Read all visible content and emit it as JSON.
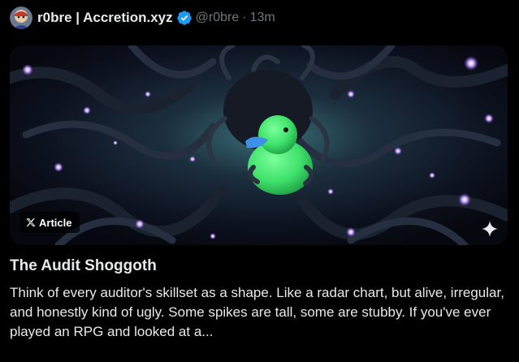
{
  "author": {
    "display_name": "r0bre | Accretion.xyz",
    "handle": "@r0bre",
    "separator": "·",
    "timestamp": "13m",
    "verified_icon": "verified-badge-icon",
    "verified_color": "#1d9bf0"
  },
  "card": {
    "badge_label": "Article",
    "badge_icon": "x-logo-icon",
    "corner_icon": "sparkle-icon"
  },
  "article": {
    "title": "The Audit Shoggoth",
    "excerpt": "Think of every auditor's skillset as a shape. Like a radar chart, but alive, irregular, and honestly kind of ugly. Some spikes are tall, some are stubby. If you've ever played an RPG and looked at a..."
  },
  "colors": {
    "background": "#000000",
    "text_primary": "#e7e9ea",
    "text_secondary": "#71767b",
    "accent_blue": "#1d9bf0",
    "duck_green": "#3ee06a",
    "glow_purple": "#9b6cff"
  }
}
